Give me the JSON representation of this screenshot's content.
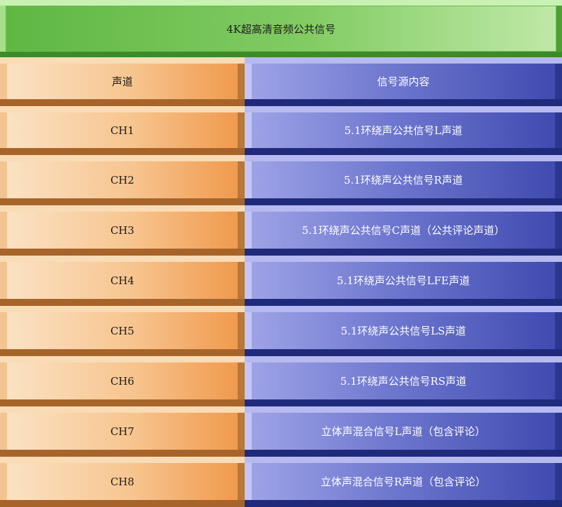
{
  "header": {
    "title": "4K超高清音频公共信号"
  },
  "columns": {
    "channel": "声道",
    "content": "信号源内容"
  },
  "rows": [
    {
      "channel": "CH1",
      "content": "5.1环绕声公共信号L声道"
    },
    {
      "channel": "CH2",
      "content": "5.1环绕声公共信号R声道"
    },
    {
      "channel": "CH3",
      "content": "5.1环绕声公共信号C声道（公共评论声道）"
    },
    {
      "channel": "CH4",
      "content": "5.1环绕声公共信号LFE声道"
    },
    {
      "channel": "CH5",
      "content": "5.1环绕声公共信号LS声道"
    },
    {
      "channel": "CH6",
      "content": "5.1环绕声公共信号RS声道"
    },
    {
      "channel": "CH7",
      "content": "立体声混合信号L声道（包含评论）"
    },
    {
      "channel": "CH8",
      "content": "立体声混合信号R声道（包含评论）"
    }
  ],
  "colors": {
    "header": "#6dbd4f",
    "channel_cell": "#f7c48e",
    "content_cell": "#4450b0"
  }
}
